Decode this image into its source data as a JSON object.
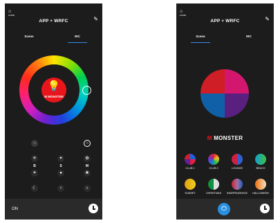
{
  "app_title": "APP + WRFC",
  "home_label": "HOME",
  "home_icon": "house-icon",
  "edit_icon": "edit-icon",
  "tabs": [
    "Scene",
    "IRC"
  ],
  "brand": {
    "logo_letter": "M",
    "name": "MONSTER"
  },
  "left_screen": {
    "active_tab": "IRC",
    "controls": {
      "row1": [
        "minus-icon",
        "circle-icon"
      ],
      "row2": [
        "sun-icon",
        "star-icon",
        "flower-icon"
      ],
      "letters": [
        "B",
        "S",
        "M"
      ],
      "row3": [
        "sun-small-icon",
        "dot-icon",
        "flower-small-icon"
      ],
      "row4": [
        "moon-icon",
        "bulb-icon",
        "bulb-outline-icon"
      ]
    },
    "footer_label": "ON"
  },
  "right_screen": {
    "active_tab": "Scene",
    "scenes": [
      {
        "label": "CLUB 1"
      },
      {
        "label": "CLUB 2"
      },
      {
        "label": "LOUNGE"
      },
      {
        "label": "BEACH"
      },
      {
        "label": "SUNSET"
      },
      {
        "label": "CHRISTMAS"
      },
      {
        "label": "INDEPENDENCE"
      },
      {
        "label": "HALLOWEEN"
      }
    ]
  },
  "colors": {
    "background": "#1c1c1c",
    "footer": "#2a2a2a",
    "accent_blue": "#2a8fe0",
    "brand_red": "#e8161c",
    "pie_quadrants": [
      "#d4176e",
      "#5a2080",
      "#1060a8",
      "#d01e26"
    ]
  }
}
